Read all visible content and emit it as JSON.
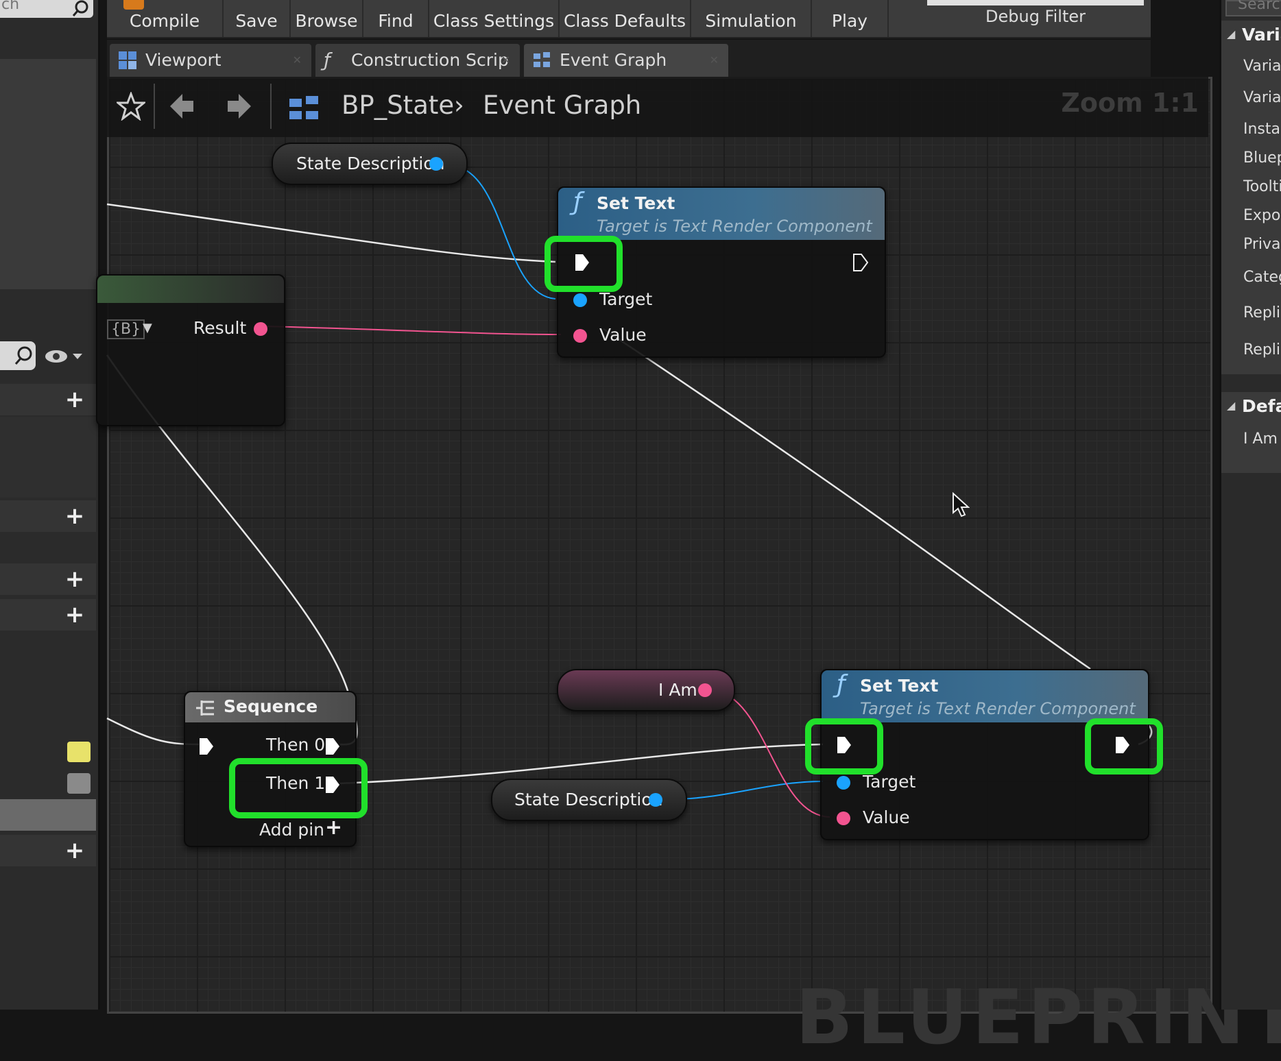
{
  "toolbar": {
    "compile": "Compile",
    "save": "Save",
    "browse": "Browse",
    "find": "Find",
    "class_settings": "Class Settings",
    "class_defaults": "Class Defaults",
    "simulation": "Simulation",
    "play": "Play",
    "debug_filter": "Debug Filter"
  },
  "left_panel": {
    "search_partial": "ch"
  },
  "tabs": [
    {
      "label": "Viewport"
    },
    {
      "label": "Construction Scrip"
    },
    {
      "label": "Event Graph"
    }
  ],
  "graph": {
    "breadcrumb_root": "BP_State",
    "breadcrumb_current": "Event Graph",
    "zoom": "Zoom 1:1",
    "watermark": "BLUEPRINT"
  },
  "nodes": {
    "state_desc_top": "State Description",
    "state_desc_bottom": "State Description",
    "i_am": "I Am",
    "set_text_1": {
      "title": "Set Text",
      "subtitle": "Target is Text Render Component",
      "pin_target": "Target",
      "pin_value": "Value"
    },
    "set_text_2": {
      "title": "Set Text",
      "subtitle": "Target is Text Render Component",
      "pin_target": "Target",
      "pin_value": "Value"
    },
    "format_node": {
      "result": "Result",
      "format_token": "{B}"
    },
    "sequence": {
      "title": "Sequence",
      "then0": "Then 0",
      "then1": "Then 1",
      "add_pin": "Add pin"
    }
  },
  "right_panel": {
    "variables_header": "Varia",
    "items": [
      "Variab",
      "Variab",
      "Instan",
      "Bluep",
      "Toolti",
      "Expos",
      "Privat",
      "Categ",
      "Replic",
      "Replic"
    ],
    "defaults_header": "Defau",
    "default_item": "I Am",
    "search_placeholder": "Search"
  },
  "colors": {
    "highlight": "#21e02b",
    "object_pin": "#1aa3ff",
    "text_pin": "#f25490",
    "function_header": "#2c5f86"
  }
}
